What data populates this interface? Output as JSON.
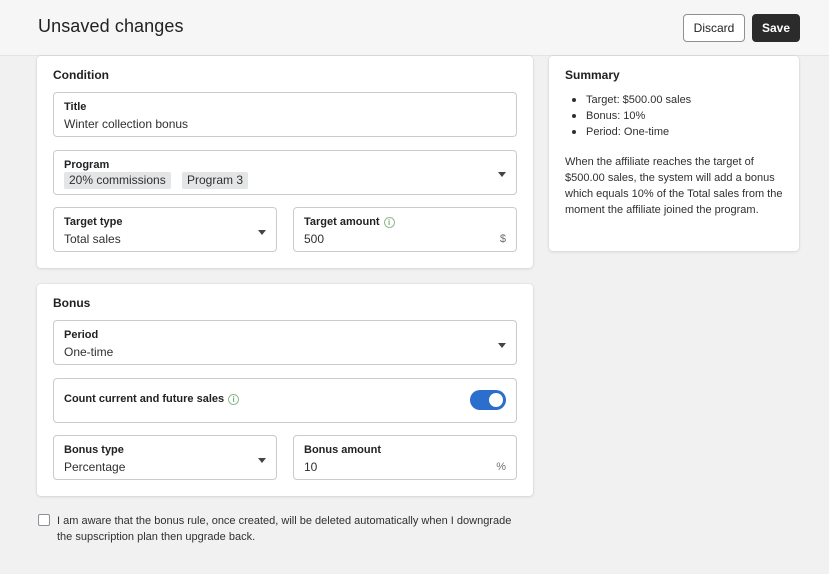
{
  "header": {
    "title": "Unsaved changes",
    "discard_label": "Discard",
    "save_label": "Save"
  },
  "condition": {
    "section_title": "Condition",
    "title_field": {
      "label": "Title",
      "value": "Winter collection bonus"
    },
    "program_field": {
      "label": "Program",
      "tags": [
        "20% commissions",
        "Program 3"
      ]
    },
    "target_type": {
      "label": "Target type",
      "value": "Total sales"
    },
    "target_amount": {
      "label": "Target amount",
      "value": "500",
      "suffix": "$"
    }
  },
  "bonus": {
    "section_title": "Bonus",
    "period": {
      "label": "Period",
      "value": "One-time"
    },
    "count_sales": {
      "label": "Count current and future sales",
      "enabled": true
    },
    "bonus_type": {
      "label": "Bonus type",
      "value": "Percentage"
    },
    "bonus_amount": {
      "label": "Bonus amount",
      "value": "10",
      "suffix": "%"
    }
  },
  "summary": {
    "title": "Summary",
    "items": [
      "Target: $500.00 sales",
      "Bonus: 10%",
      "Period: One-time"
    ],
    "description": "When the affiliate reaches the target of $500.00 sales, the system will add a bonus which equals 10% of the Total sales from the moment the affiliate joined the program."
  },
  "agreement": {
    "text": "I am aware that the bonus rule, once created, will be deleted automatically when I downgrade the supscription plan then upgrade back.",
    "checked": false
  },
  "colors": {
    "toggle_on": "#2c6ecb",
    "save_button": "#2b2b2b"
  },
  "icons": {
    "info": "info-circle-icon",
    "dropdown": "chevron-down-icon"
  }
}
